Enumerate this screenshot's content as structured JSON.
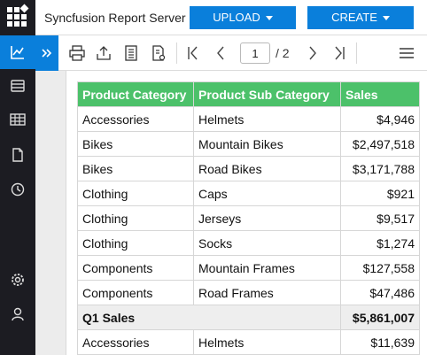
{
  "header": {
    "app_title": "Syncfusion Report Server",
    "upload_label": "UPLOAD",
    "create_label": "CREATE"
  },
  "sidebar": {
    "items": [
      {
        "name": "reports-icon",
        "active": true
      },
      {
        "name": "datasources-icon",
        "active": false
      },
      {
        "name": "datasets-icon",
        "active": false
      },
      {
        "name": "files-icon",
        "active": false
      },
      {
        "name": "schedules-icon",
        "active": false
      },
      {
        "name": "settings-icon",
        "active": false
      },
      {
        "name": "user-icon",
        "active": false
      }
    ]
  },
  "toolbar": {
    "current_page": "1",
    "total_pages": "/ 2"
  },
  "report": {
    "columns": [
      "Product Category",
      "Product Sub Category",
      "Sales"
    ],
    "rows": [
      {
        "category": "Accessories",
        "sub": "Helmets",
        "sales": "$4,946"
      },
      {
        "category": "Bikes",
        "sub": "Mountain Bikes",
        "sales": "$2,497,518"
      },
      {
        "category": "Bikes",
        "sub": "Road Bikes",
        "sales": "$3,171,788"
      },
      {
        "category": "Clothing",
        "sub": "Caps",
        "sales": "$921"
      },
      {
        "category": "Clothing",
        "sub": "Jerseys",
        "sales": "$9,517"
      },
      {
        "category": "Clothing",
        "sub": "Socks",
        "sales": "$1,274"
      },
      {
        "category": "Components",
        "sub": "Mountain Frames",
        "sales": "$127,558"
      },
      {
        "category": "Components",
        "sub": "Road Frames",
        "sales": "$47,486"
      }
    ],
    "subtotal": {
      "label": "Q1 Sales",
      "value": "$5,861,007"
    },
    "after_rows": [
      {
        "category": "Accessories",
        "sub": "Helmets",
        "sales": "$11,639"
      }
    ]
  },
  "colors": {
    "brand_blue": "#0a7fdb",
    "nav_dark": "#1c1c22",
    "header_green": "#4cc16a"
  }
}
